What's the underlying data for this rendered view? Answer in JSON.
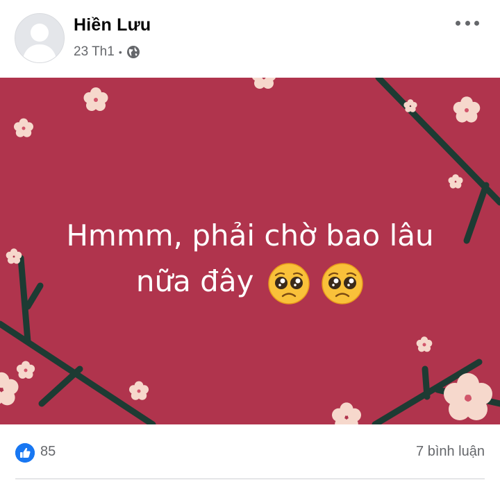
{
  "post": {
    "author": "Hiền Lưu",
    "date": "23 Th1",
    "separator": "•",
    "privacy_icon": "globe-icon",
    "more_icon": "more-options-icon",
    "image_text_line1": "Hmmm, phải chờ bao lâu",
    "image_text_line2": "nữa đây",
    "emoji": "pleading-face-emoji",
    "card_background": "#b0344d"
  },
  "footer": {
    "reaction_icon": "like-icon",
    "like_count": "85",
    "comment_count": "7 bình luận"
  },
  "colors": {
    "brand_blue": "#1877f2",
    "secondary_text": "#65676b"
  }
}
